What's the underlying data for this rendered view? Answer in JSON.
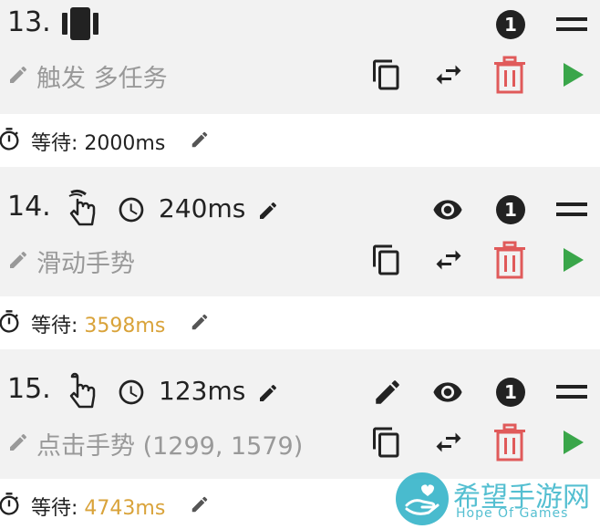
{
  "steps": [
    {
      "number": "13.",
      "label": "触发 多任务",
      "wait_prefix": "等待:",
      "wait_value": "2000ms",
      "wait_color": "#222222"
    },
    {
      "number": "14.",
      "delay": "240ms",
      "label": "滑动手势",
      "wait_prefix": "等待:",
      "wait_value": "3598ms",
      "wait_color": "#d9a33a"
    },
    {
      "number": "15.",
      "delay": "123ms",
      "label": "点击手势 (1299, 1579)",
      "wait_prefix": "等待:",
      "wait_value": "4743ms",
      "wait_color": "#d9a33a"
    }
  ],
  "badge_count": "1",
  "colors": {
    "delete": "#e05a5a",
    "play": "#3aa64a",
    "icon": "#222222",
    "label": "#999999"
  },
  "watermark": {
    "text": "希望手游网",
    "subtext": "Hope Of Games"
  }
}
